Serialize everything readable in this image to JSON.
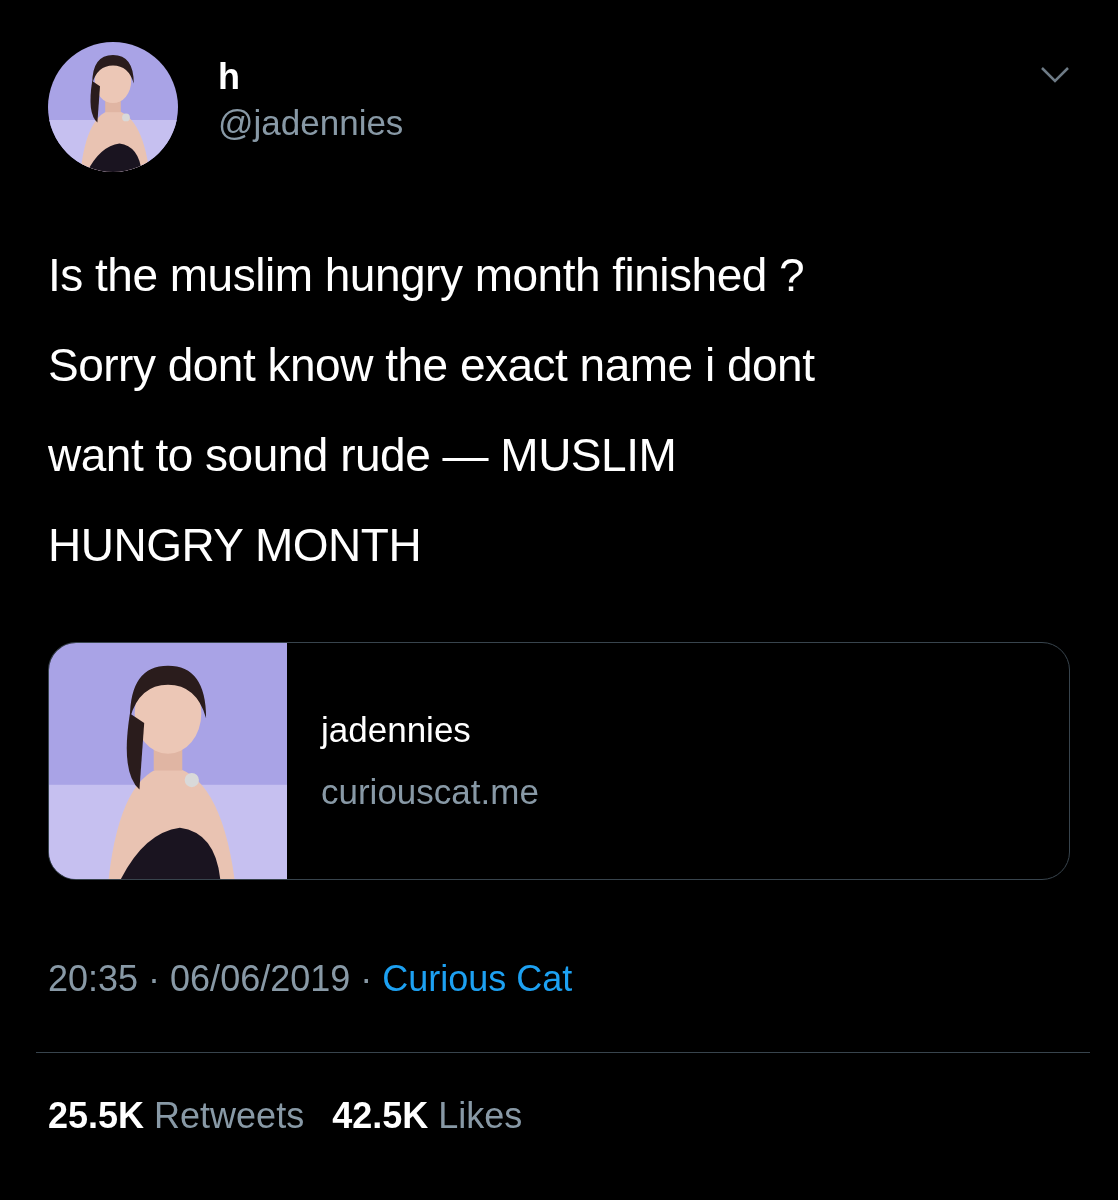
{
  "author": {
    "name": "h",
    "handle": "@jadennies"
  },
  "text": "Is the muslim hungry month finished ?\nSorry dont know the exact name i dont\nwant to sound rude — MUSLIM\nHUNGRY MONTH",
  "card": {
    "title": "jadennies",
    "domain": "curiouscat.me"
  },
  "meta": {
    "time": "20:35 · 06/06/2019 ·",
    "source": "Curious Cat"
  },
  "stats": [
    {
      "text": "**25.5K** Retweets"
    },
    {
      "text": "**42.5K** Likes"
    }
  ]
}
